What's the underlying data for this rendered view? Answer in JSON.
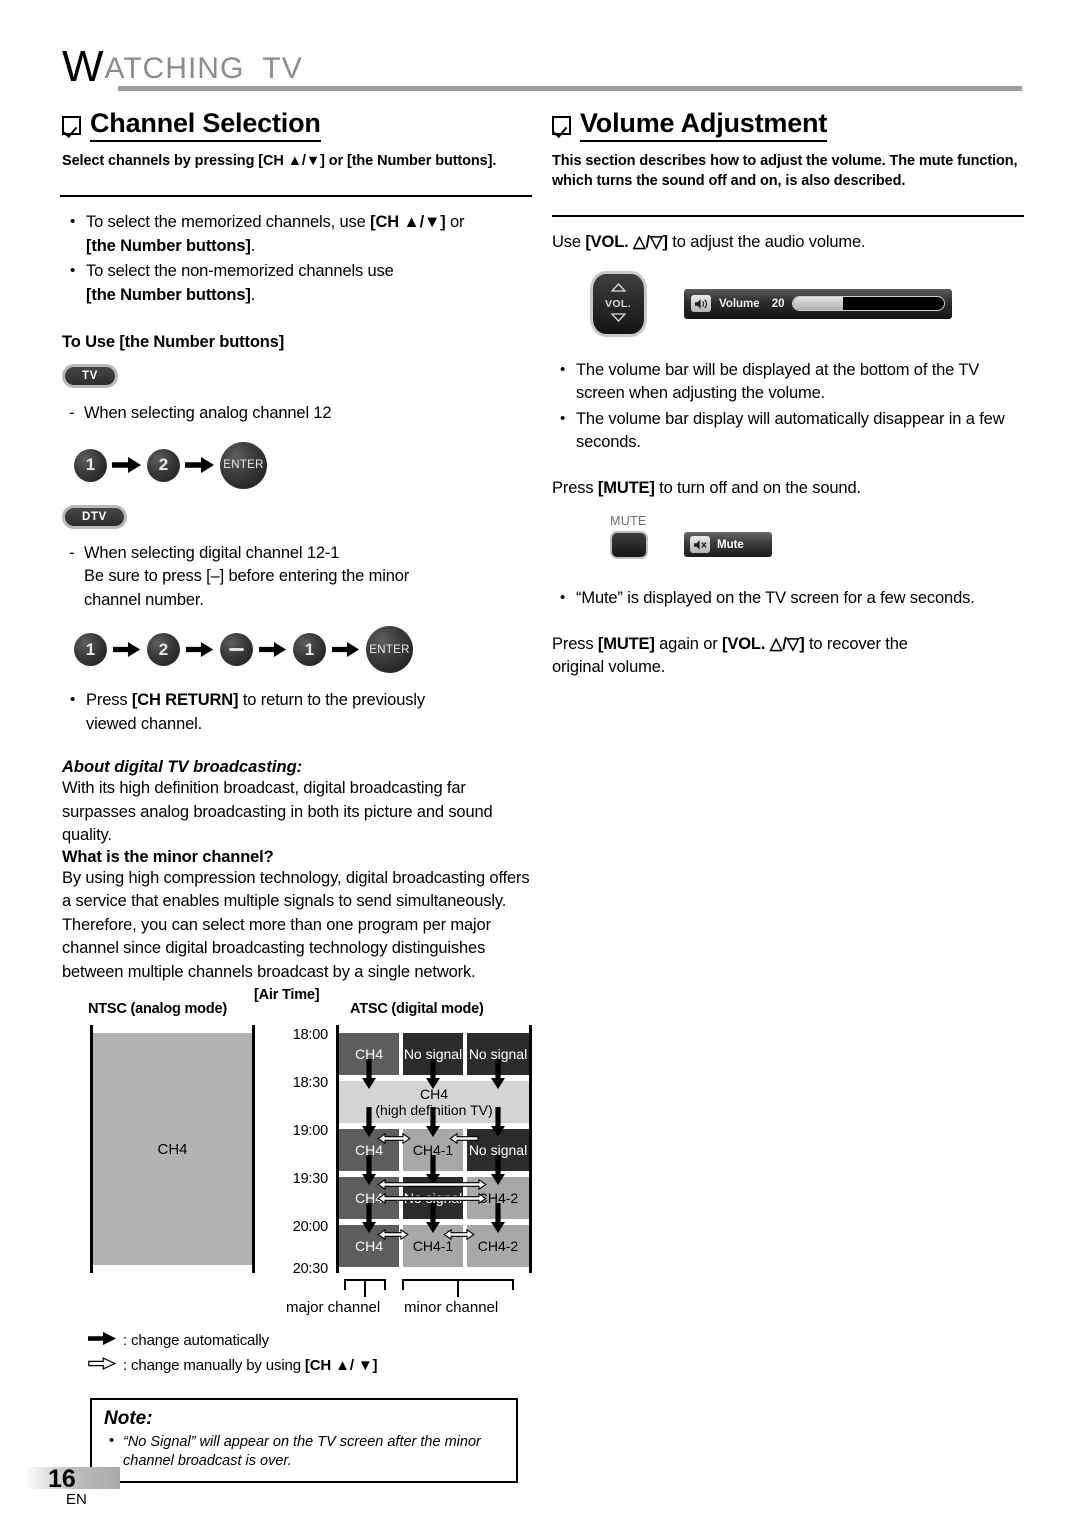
{
  "page": {
    "header_title_first": "W",
    "header_title_rest": "ATCHING  TV",
    "number": "16",
    "language": "EN"
  },
  "left": {
    "section_title": "Channel Selection",
    "section_subtitle": "Select channels by pressing [CH ▲/▼] or [the Number buttons].",
    "bullets": [
      {
        "plain1": "To select the memorized channels, use ",
        "bold1": "[CH ▲/▼]",
        "plain2": " or",
        "bold2": "[the Number buttons]",
        "plain3": "."
      },
      {
        "plain1": "To select the non-memorized channels use",
        "bold1": "",
        "plain2": "",
        "bold2": "[the Number buttons]",
        "plain3": "."
      }
    ],
    "to_use_heading": "To Use [the Number buttons]",
    "badge_tv": "TV",
    "badge_dtv": "DTV",
    "analog_line": "When selecting analog channel 12",
    "analog_sequence": [
      "1",
      "2",
      "ENTER"
    ],
    "digital_line1": "When selecting digital channel 12-1",
    "digital_line2": "Be sure to press [–] before entering the minor",
    "digital_line3": "channel number.",
    "digital_sequence": [
      "1",
      "2",
      "–",
      "1",
      "ENTER"
    ],
    "ch_return_bullet_1": "Press ",
    "ch_return_bold": "[CH RETURN]",
    "ch_return_bullet_2": " to return to the previously",
    "ch_return_bullet_3": "viewed channel.",
    "about_heading": "About digital TV broadcasting:",
    "about_paragraph": "With its high definition broadcast, digital broadcasting far surpasses analog broadcasting in both its picture and sound quality.",
    "minor_heading": "What is the minor channel?",
    "minor_paragraph_1": "By using high compression technology, digital broadcasting offers a service that enables multiple signals to send simultaneously.",
    "minor_paragraph_2": "Therefore, you can select more than one program per major channel since digital broadcasting technology distinguishes between multiple channels broadcast by a single network.",
    "legend_auto": ": change automatically",
    "legend_manual_plain": ": change manually by using ",
    "legend_manual_bold": "[CH ▲/ ▼]",
    "note": {
      "title": "Note:",
      "items": [
        "“No Signal” will appear on the TV screen after the minor channel broadcast is over."
      ]
    }
  },
  "diagram": {
    "ntsc_header": "NTSC (analog mode)",
    "airtime_header": "[Air Time]",
    "atsc_header": "ATSC (digital mode)",
    "ntsc_block_label": "CH4",
    "times": [
      "18:00",
      "18:30",
      "19:00",
      "19:30",
      "20:00",
      "20:30"
    ],
    "cells": [
      {
        "label": "CH4",
        "kind": "sig"
      },
      {
        "label": "No signal",
        "kind": "nosig"
      },
      {
        "label": "No signal",
        "kind": "nosig"
      },
      {
        "label": "CH4",
        "label2": "(high definition TV)",
        "kind": "hd"
      },
      {
        "label": "CH4",
        "kind": "sig"
      },
      {
        "label": "CH4-1",
        "kind": "minor"
      },
      {
        "label": "No signal",
        "kind": "nosig"
      },
      {
        "label": "CH4",
        "kind": "sig"
      },
      {
        "label": "No signal",
        "kind": "nosig"
      },
      {
        "label": "CH4-2",
        "kind": "minor"
      },
      {
        "label": "CH4",
        "kind": "sig"
      },
      {
        "label": "CH4-1",
        "kind": "minor"
      },
      {
        "label": "CH4-2",
        "kind": "minor"
      }
    ],
    "major_label": "major channel",
    "minor_label": "minor channel"
  },
  "right": {
    "section_title": "Volume Adjustment",
    "section_subtitle": "This section describes how to adjust the volume. The mute function, which turns the sound off and on, is also described.",
    "use_vol_plain1": "Use ",
    "use_vol_bold": "[VOL. △/▽]",
    "use_vol_plain2": " to adjust the audio volume.",
    "vol_key_label": "VOL.",
    "osd_volume_label": "Volume",
    "osd_volume_value": "20",
    "osd_volume_percent": 33,
    "bullets": [
      "The volume bar will be displayed at the bottom of the TV screen when adjusting the volume.",
      "The volume bar display will automatically disappear in a few seconds."
    ],
    "press_mute_plain1": "Press ",
    "press_mute_bold": "[MUTE]",
    "press_mute_plain2": " to turn off and on the sound.",
    "mute_key_caption": "MUTE",
    "osd_mute_label": "Mute",
    "mute_bullet": "“Mute” is displayed on the TV screen for a few seconds.",
    "recover_plain1": "Press ",
    "recover_bold1": "[MUTE]",
    "recover_plain2": " again or ",
    "recover_bold2": "[VOL. △/▽]",
    "recover_plain3": " to recover the",
    "recover_plain4": "original volume."
  },
  "colors": {
    "header_gray": "#8c8c8c",
    "rule_gray": "#9d9d9d",
    "signal_gray": "#5d5d5d",
    "nosignal_dark": "#2b2b2b",
    "minor_gray": "#a8a8a8",
    "hd_light": "#d4d4d4",
    "ntsc_block": "#b3b3b3"
  }
}
